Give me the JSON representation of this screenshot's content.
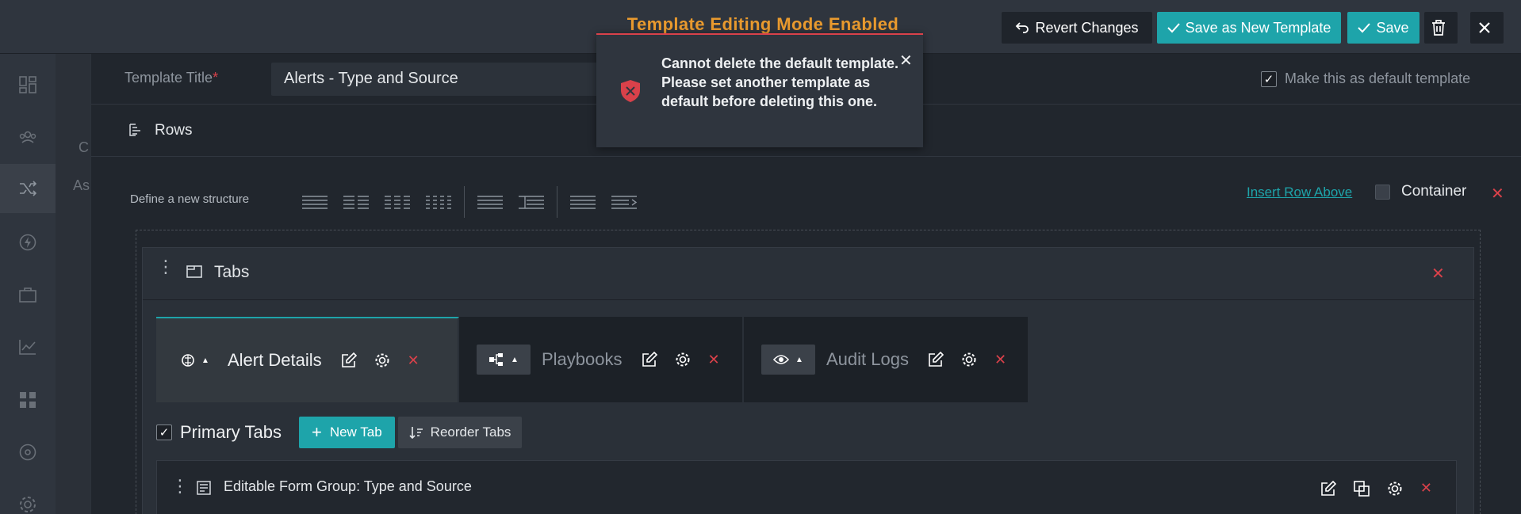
{
  "header": {
    "mode_title": "Template Editing Mode Enabled",
    "revert_label": "Revert Changes",
    "save_new_label": "Save as New Template",
    "save_label": "Save"
  },
  "toast": {
    "message": "Cannot delete the default template. Please set another template as default before deleting this one."
  },
  "left_nav": {
    "icons": [
      "dashboard-icon",
      "users-icon",
      "shuffle-icon",
      "bolt-icon",
      "briefcase-icon",
      "chart-icon",
      "widgets-icon",
      "helm-icon",
      "gear-icon"
    ],
    "background_text": [
      "C",
      "As"
    ]
  },
  "form": {
    "title_label": "Template Title",
    "required_mark": "*",
    "title_value": "Alerts - Type and Source",
    "default_label": "Make this as default template",
    "default_checked": true
  },
  "rows": {
    "label": "Rows",
    "define_label": "Define a new structure",
    "insert_row_label": "Insert Row Above",
    "container_label": "Container"
  },
  "tabs_widget": {
    "label": "Tabs",
    "tabs": [
      {
        "label": "Alert Details",
        "active": true
      },
      {
        "label": "Playbooks",
        "active": false
      },
      {
        "label": "Audit Logs",
        "active": false
      }
    ],
    "primary_tabs_label": "Primary Tabs",
    "new_tab_label": "New Tab",
    "reorder_tabs_label": "Reorder Tabs",
    "form_group_label": "Editable Form Group: Type and Source"
  },
  "colors": {
    "accent": "#1ea4aa",
    "warning": "#e99a2e",
    "danger": "#d9414a"
  }
}
